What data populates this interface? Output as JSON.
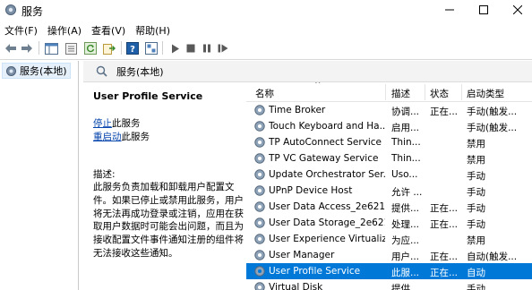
{
  "window": {
    "title": "服务",
    "icon": "gear-window-icon",
    "controls": [
      "minimize-icon",
      "maximize-icon",
      "close-icon"
    ]
  },
  "menu": [
    "文件(F)",
    "操作(A)",
    "查看(V)",
    "帮助(H)"
  ],
  "toolbar": {
    "buttons": [
      "back-arrow-icon",
      "forward-arrow-icon",
      "console-tree-icon",
      "properties-icon",
      "refresh-icon",
      "export-icon",
      "help-icon",
      "view-icon",
      "play-icon",
      "stop-icon",
      "pause-icon",
      "restart-icon"
    ]
  },
  "tree": {
    "root_label": "服务(本地)"
  },
  "main": {
    "header_label": "服务(本地)",
    "selected_service": "User Profile Service",
    "stop_link": "停止",
    "stop_suffix": "此服务",
    "restart_link": "重启动",
    "restart_suffix": "此服务",
    "description_label": "描述:",
    "description_text": "此服务负责加载和卸载用户配置文件。如果已停止或禁用此服务，用户将无法再成功登录或注销，应用在获取用户数据时可能会出问题，而且为接收配置文件事件通知注册的组件将无法接收这些通知。"
  },
  "columns": {
    "name": "名称",
    "desc": "描述",
    "status": "状态",
    "startup": "启动类型"
  },
  "services": [
    {
      "name": "Time Broker",
      "desc": "协调...",
      "status": "正在...",
      "startup": "手动(触发..."
    },
    {
      "name": "Touch Keyboard and Ha...",
      "desc": "启用...",
      "status": "",
      "startup": "手动(触发..."
    },
    {
      "name": "TP AutoConnect Service",
      "desc": "Thin...",
      "status": "",
      "startup": "禁用"
    },
    {
      "name": "TP VC Gateway Service",
      "desc": "Thin...",
      "status": "",
      "startup": "禁用"
    },
    {
      "name": "Update Orchestrator Ser...",
      "desc": "Uso...",
      "status": "",
      "startup": "手动"
    },
    {
      "name": "UPnP Device Host",
      "desc": "允许 ...",
      "status": "",
      "startup": "手动"
    },
    {
      "name": "User Data Access_2e621",
      "desc": "提供...",
      "status": "正在...",
      "startup": "手动"
    },
    {
      "name": "User Data Storage_2e621",
      "desc": "处理...",
      "status": "正在...",
      "startup": "手动"
    },
    {
      "name": "User Experience Virtualiz...",
      "desc": "为应...",
      "status": "",
      "startup": "禁用"
    },
    {
      "name": "User Manager",
      "desc": "用户...",
      "status": "正在...",
      "startup": "自动(触发..."
    },
    {
      "name": "User Profile Service",
      "desc": "此服...",
      "status": "正在...",
      "startup": "自动",
      "selected": true
    },
    {
      "name": "Virtual Disk",
      "desc": "提供...",
      "status": "",
      "startup": "手动"
    }
  ]
}
